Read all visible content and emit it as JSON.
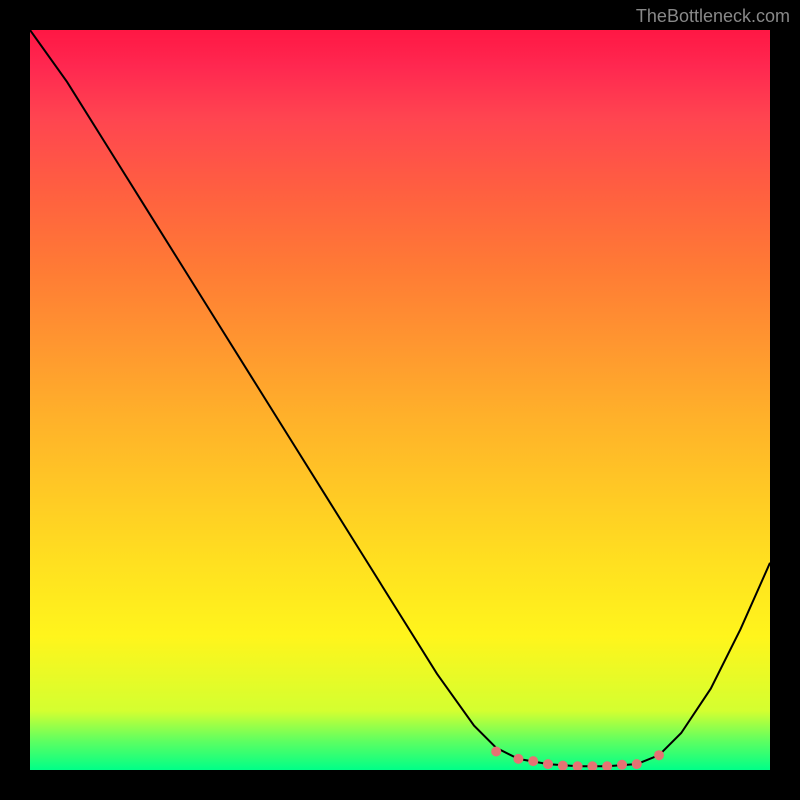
{
  "watermark": "TheBottleneck.com",
  "chart_data": {
    "type": "line",
    "title": "",
    "xlabel": "",
    "ylabel": "",
    "xlim": [
      0,
      100
    ],
    "ylim": [
      0,
      100
    ],
    "x": [
      0,
      5,
      10,
      15,
      20,
      25,
      30,
      35,
      40,
      45,
      50,
      55,
      60,
      63,
      66,
      70,
      74,
      78,
      82,
      85,
      88,
      92,
      96,
      100
    ],
    "values": [
      100,
      93,
      85,
      77,
      69,
      61,
      53,
      45,
      37,
      29,
      21,
      13,
      6,
      3,
      1.5,
      0.8,
      0.5,
      0.5,
      0.8,
      2,
      5,
      11,
      19,
      28
    ],
    "dots": {
      "x": [
        63,
        66,
        68,
        70,
        72,
        74,
        76,
        78,
        80,
        82,
        85
      ],
      "y": [
        2.5,
        1.5,
        1.2,
        0.8,
        0.6,
        0.5,
        0.5,
        0.5,
        0.7,
        0.8,
        2
      ]
    }
  }
}
